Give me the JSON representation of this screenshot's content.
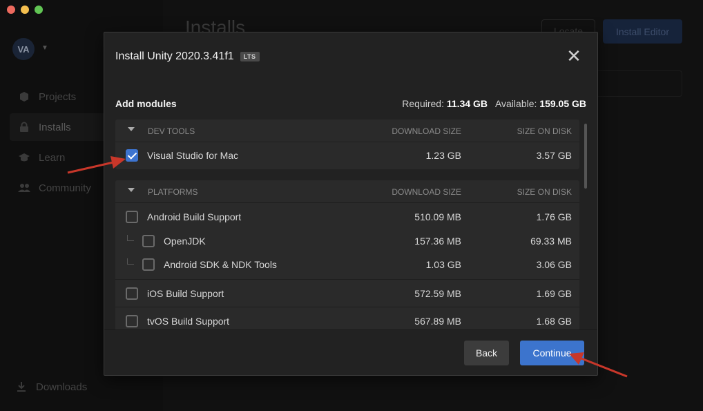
{
  "window": {
    "traffic_lights": {
      "close": "#ed6a5e",
      "minimize": "#f4bf4f",
      "zoom": "#61c554"
    }
  },
  "sidebar": {
    "avatar_initials": "VA",
    "items": [
      {
        "label": "Projects",
        "icon": "cube-icon"
      },
      {
        "label": "Installs",
        "icon": "lock-icon",
        "active": true
      },
      {
        "label": "Learn",
        "icon": "graduation-cap-icon"
      },
      {
        "label": "Community",
        "icon": "people-icon"
      }
    ],
    "downloads_label": "Downloads"
  },
  "main": {
    "title": "Installs",
    "locate_label": "Locate",
    "install_editor_label": "Install Editor"
  },
  "dialog": {
    "title": "Install Unity 2020.3.41f1",
    "badge": "LTS",
    "add_modules_label": "Add modules",
    "required_label": "Required:",
    "required_value": "11.34 GB",
    "available_label": "Available:",
    "available_value": "159.05 GB",
    "groups": [
      {
        "name": "DEV TOOLS",
        "col_download": "DOWNLOAD SIZE",
        "col_disk": "SIZE ON DISK",
        "rows": [
          {
            "name": "Visual Studio for Mac",
            "download": "1.23 GB",
            "disk": "3.57 GB",
            "checked": true
          }
        ]
      },
      {
        "name": "PLATFORMS",
        "col_download": "DOWNLOAD SIZE",
        "col_disk": "SIZE ON DISK",
        "rows": [
          {
            "name": "Android Build Support",
            "download": "510.09 MB",
            "disk": "1.76 GB",
            "checked": false
          },
          {
            "name": "OpenJDK",
            "download": "157.36 MB",
            "disk": "69.33 MB",
            "checked": false,
            "child": true
          },
          {
            "name": "Android SDK & NDK Tools",
            "download": "1.03 GB",
            "disk": "3.06 GB",
            "checked": false,
            "child": true
          },
          {
            "name": "iOS Build Support",
            "download": "572.59 MB",
            "disk": "1.69 GB",
            "checked": false
          },
          {
            "name": "tvOS Build Support",
            "download": "567.89 MB",
            "disk": "1.68 GB",
            "checked": false
          }
        ]
      }
    ],
    "back_label": "Back",
    "continue_label": "Continue"
  },
  "annotations": {
    "arrow_color": "#c8372a"
  }
}
